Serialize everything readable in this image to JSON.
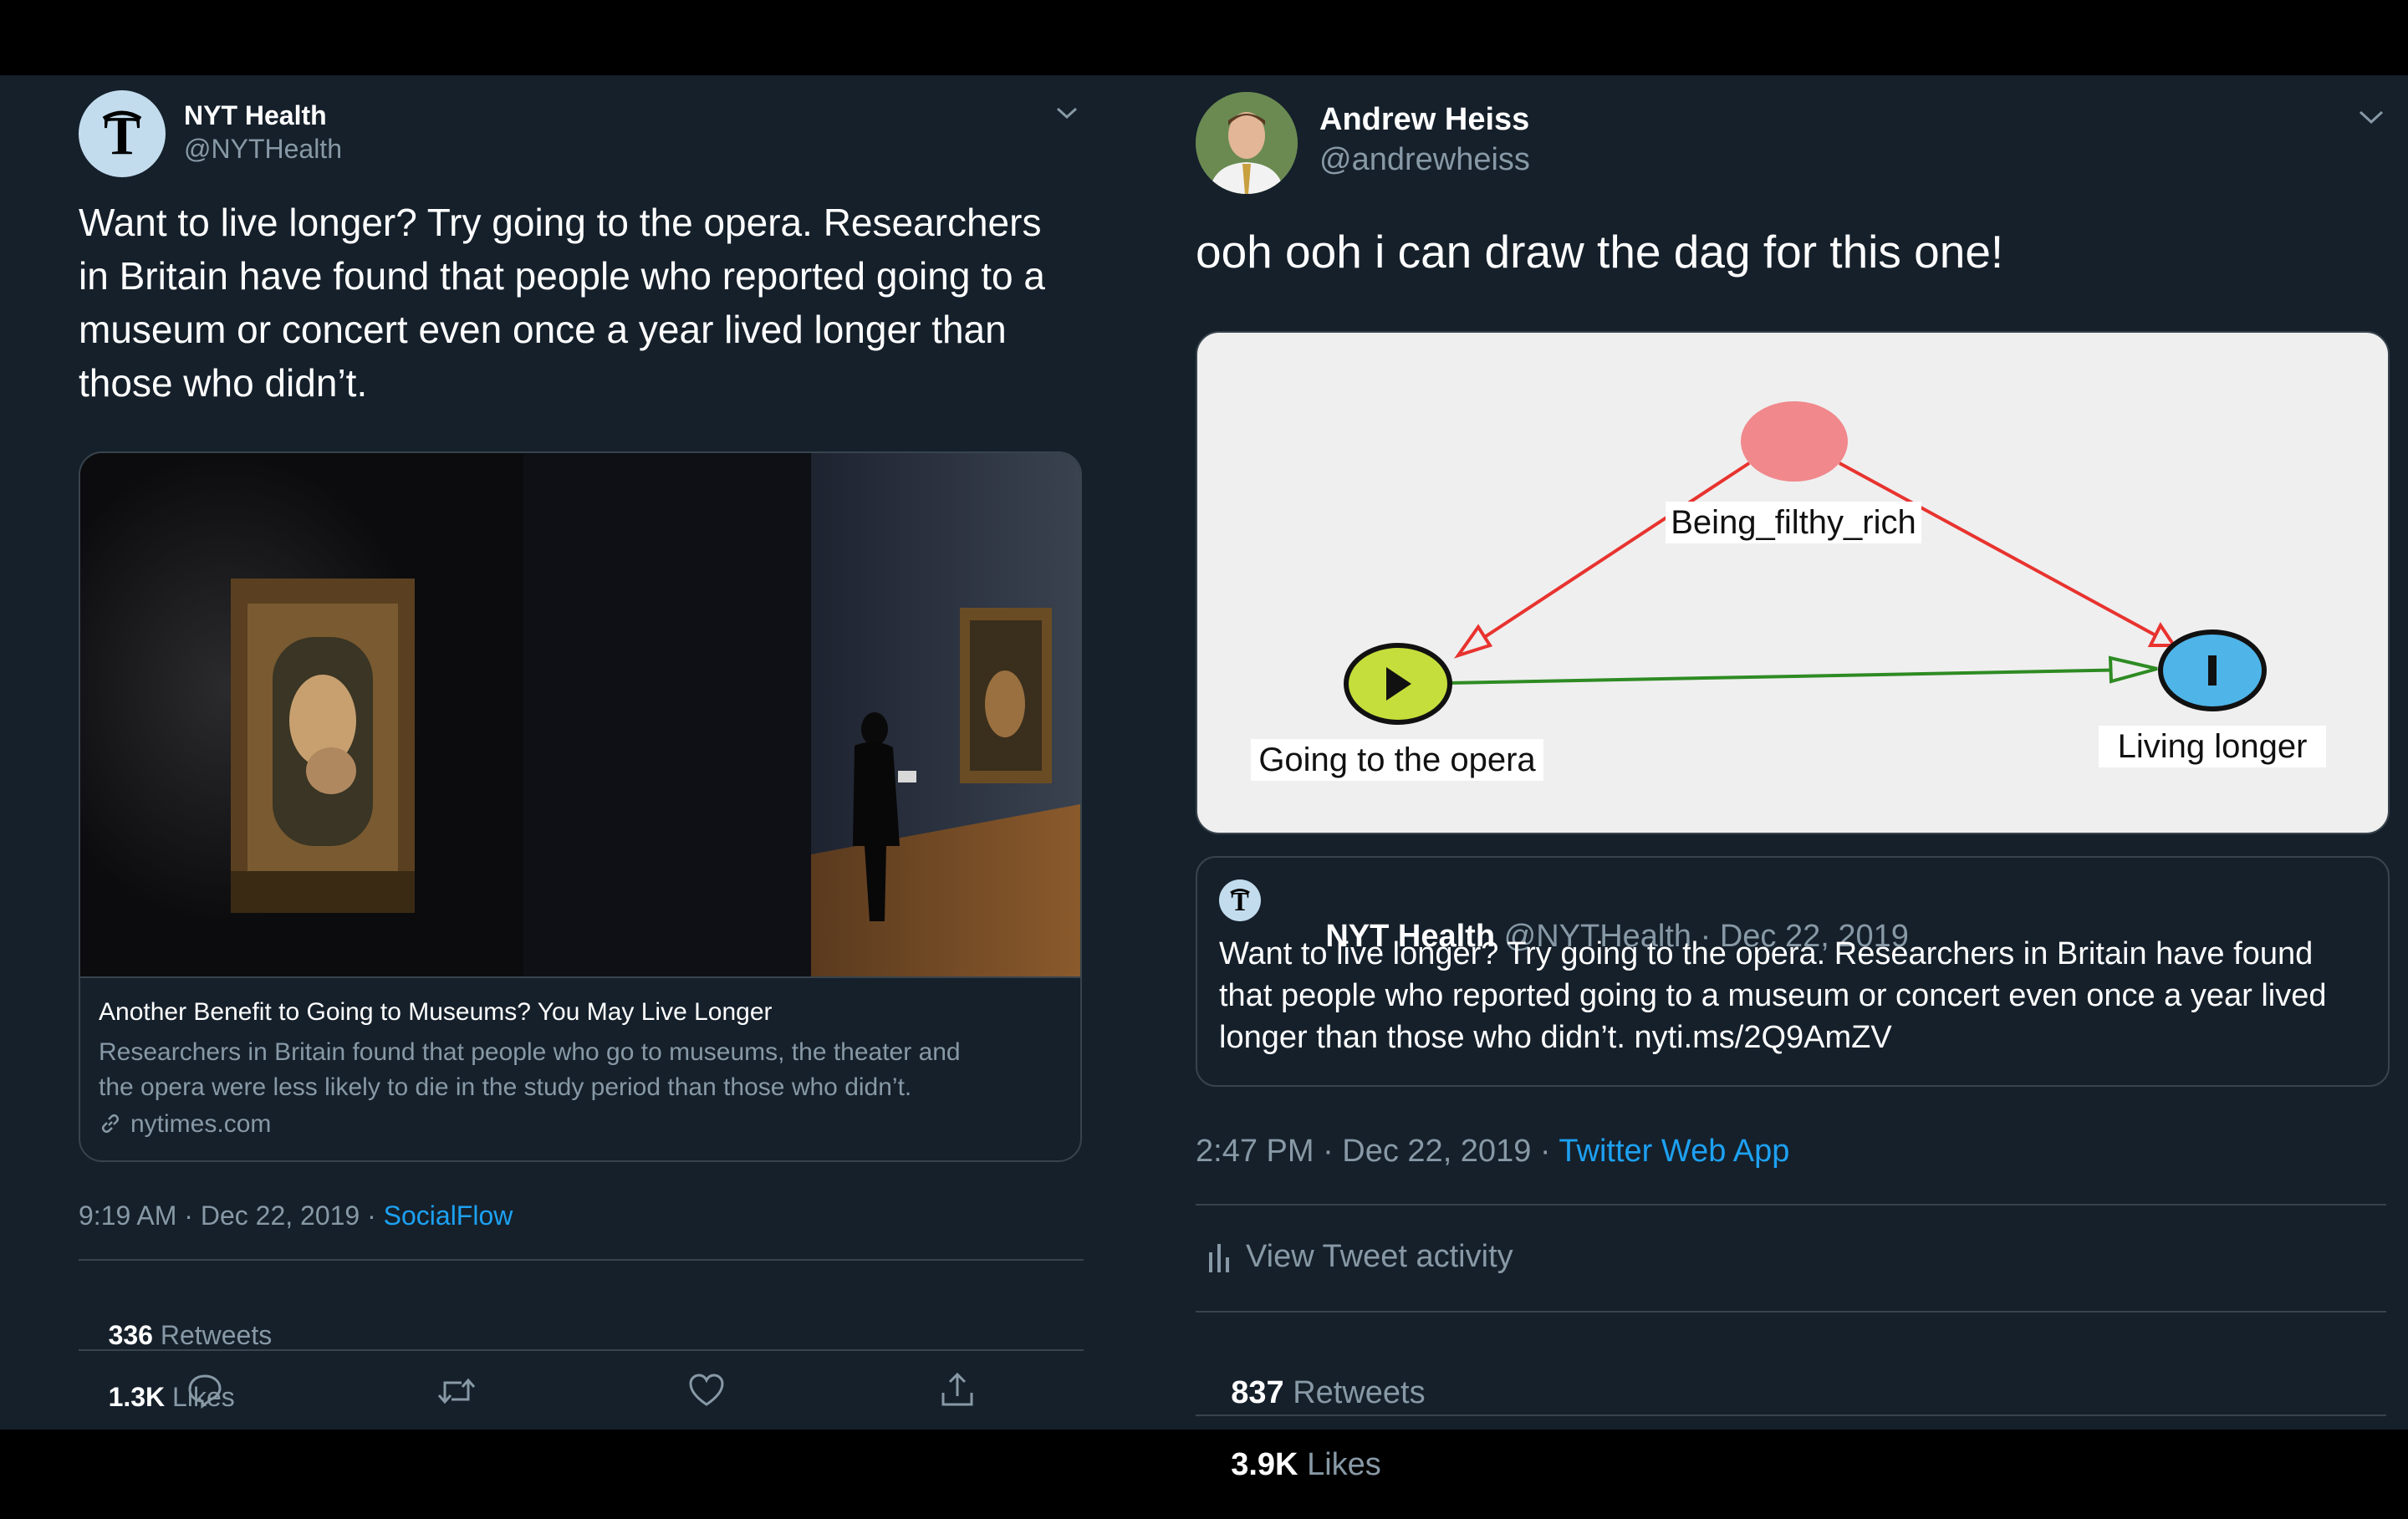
{
  "left_tweet": {
    "author_name": "NYT Health",
    "author_handle": "@NYTHealth",
    "text_lines": [
      "Want to live longer? Try going to the opera. Researchers",
      "in Britain have found that people who reported going to a",
      "museum or concert even once a year lived longer than",
      "those who didn’t."
    ],
    "link_card": {
      "title": "Another Benefit to Going to Museums? You May Live Longer",
      "description_lines": [
        "Researchers in Britain found that people who go to museums, the theater and",
        "the opera were less likely to die in the study period than those who didn’t."
      ],
      "domain": "nytimes.com"
    },
    "timestamp": "9:19 AM · Dec 22, 2019 · ",
    "source": "SocialFlow",
    "retweets_count": "336",
    "retweets_label": "Retweets",
    "likes_count": "1.3K",
    "likes_label": "Likes"
  },
  "right_tweet": {
    "author_name": "Andrew Heiss",
    "author_handle": "@andrewheiss",
    "text": "ooh ooh i can draw the dag for this one!",
    "dag": {
      "nodes": [
        {
          "id": "confounder",
          "label": "Being_filthy_rich",
          "color": "#f0888c"
        },
        {
          "id": "exposure",
          "label": "Going to the opera",
          "color": "#c5de3c"
        },
        {
          "id": "outcome",
          "label": "Living longer",
          "color": "#4fb4e8"
        }
      ],
      "edges": [
        {
          "from": "confounder",
          "to": "exposure",
          "color": "#e8332f"
        },
        {
          "from": "confounder",
          "to": "outcome",
          "color": "#e8332f"
        },
        {
          "from": "exposure",
          "to": "outcome",
          "color": "#2e8b23"
        }
      ]
    },
    "quoted": {
      "author_name": "NYT Health",
      "author_meta": "@NYTHealth · Dec 22, 2019",
      "text_lines": [
        "Want to live longer? Try going to the opera. Researchers in Britain have found",
        "that people who reported going to a museum or concert even once a year lived",
        "longer than those who didn’t.  nyti.ms/2Q9AmZV"
      ]
    },
    "timestamp": "2:47 PM · Dec 22, 2019 · ",
    "source": "Twitter Web App",
    "activity_label": "View Tweet activity",
    "retweets_count": "837",
    "retweets_label": "Retweets",
    "likes_count": "3.9K",
    "likes_label": "Likes"
  },
  "colors": {
    "background": "#15202b",
    "accent": "#1da1f2",
    "divider": "#38444d"
  }
}
